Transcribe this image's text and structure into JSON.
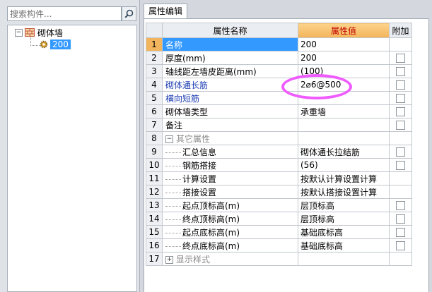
{
  "search": {
    "placeholder": "搜索构件..."
  },
  "tree": {
    "root": {
      "label": "砌体墙",
      "toggle": "−"
    },
    "children": [
      {
        "label": "200"
      }
    ]
  },
  "tab": {
    "label": "属性编辑"
  },
  "table": {
    "headers": {
      "name": "属性名称",
      "value": "属性值",
      "extra": "附加"
    },
    "rows": [
      {
        "num": "1",
        "name": "名称",
        "value": "200",
        "checkbox": false
      },
      {
        "num": "2",
        "name": "厚度(mm)",
        "value": "200",
        "checkbox": true
      },
      {
        "num": "3",
        "name": "轴线距左墙皮距离(mm)",
        "value": "(100)",
        "checkbox": true
      },
      {
        "num": "4",
        "name": "砌体通长筋",
        "value": "2⌀6@500",
        "checkbox": true
      },
      {
        "num": "5",
        "name": "横向短筋",
        "value": "",
        "checkbox": true
      },
      {
        "num": "6",
        "name": "砌体墙类型",
        "value": "承重墙",
        "checkbox": true
      },
      {
        "num": "7",
        "name": "备注",
        "value": "",
        "checkbox": true
      },
      {
        "num": "8",
        "name": "其它属性",
        "value": "",
        "checkbox": false,
        "toggle": "−"
      },
      {
        "num": "9",
        "name": "汇总信息",
        "value": "砌体通长拉结筋",
        "checkbox": true
      },
      {
        "num": "10",
        "name": "钢筋搭接",
        "value": "(56)",
        "checkbox": true
      },
      {
        "num": "11",
        "name": "计算设置",
        "value": "按默认计算设置计算",
        "checkbox": false
      },
      {
        "num": "12",
        "name": "搭接设置",
        "value": "按默认搭接设置计算",
        "checkbox": false
      },
      {
        "num": "13",
        "name": "起点顶标高(m)",
        "value": "层顶标高",
        "checkbox": true
      },
      {
        "num": "14",
        "name": "终点顶标高(m)",
        "value": "层顶标高",
        "checkbox": true
      },
      {
        "num": "15",
        "name": "起点底标高(m)",
        "value": "基础底标高",
        "checkbox": true
      },
      {
        "num": "16",
        "name": "终点底标高(m)",
        "value": "基础底标高",
        "checkbox": true
      },
      {
        "num": "17",
        "name": "显示样式",
        "value": "",
        "checkbox": false,
        "toggle": "+"
      }
    ]
  },
  "colors": {
    "selected_row": "#3399ff",
    "value_header": "#f3b45a",
    "link_text": "#1f3fb4",
    "highlight_ring": "#f05bff"
  },
  "icons": {
    "search": "search-icon",
    "wall": "wall-icon",
    "gear": "gear-icon"
  }
}
